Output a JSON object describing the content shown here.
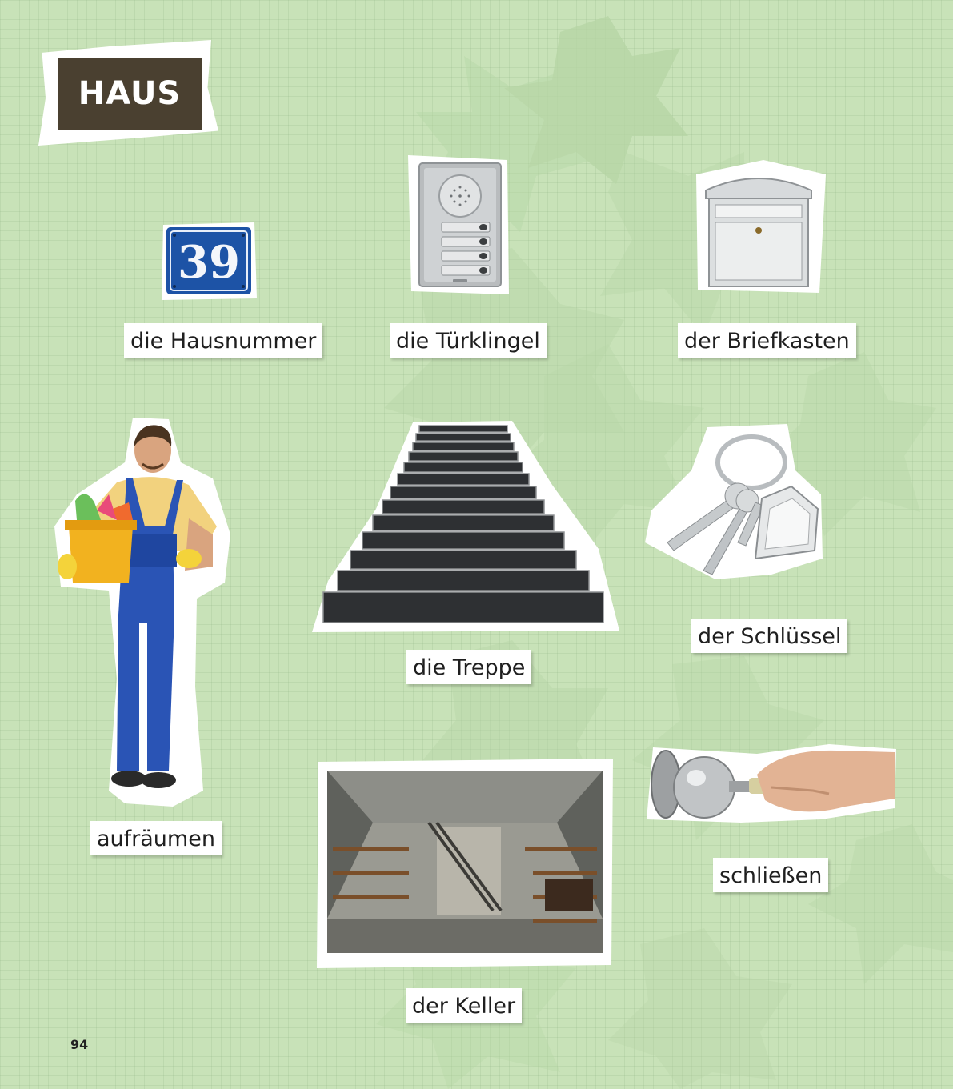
{
  "page": {
    "title": "HAUS",
    "page_number": "94",
    "background_color": "#c8e2b8",
    "title_box_color": "#4a4030"
  },
  "house_number": {
    "digits": "39",
    "plate_color": "#1d53a6"
  },
  "items": [
    {
      "word": "die Hausnummer",
      "icon": "house-number-plate-icon"
    },
    {
      "word": "die Türklingel",
      "icon": "doorbell-panel-icon"
    },
    {
      "word": "der Briefkasten",
      "icon": "mailbox-icon"
    },
    {
      "word": "aufräumen",
      "icon": "cleaning-man-icon"
    },
    {
      "word": "die Treppe",
      "icon": "staircase-icon"
    },
    {
      "word": "der Schlüssel",
      "icon": "keys-icon"
    },
    {
      "word": "der Keller",
      "icon": "cellar-icon"
    },
    {
      "word": "schließen",
      "icon": "key-in-lock-icon"
    }
  ]
}
